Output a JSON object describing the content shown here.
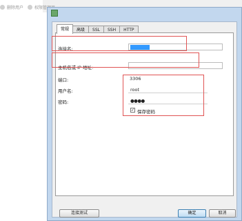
{
  "toolbar": {
    "delete_user": "删除用户",
    "privilege_manager": "权限管理器"
  },
  "tabs": [
    "常规",
    "高级",
    "SSL",
    "SSH",
    "HTTP"
  ],
  "form": {
    "connection_name_label": "连接名:",
    "host_label": "主机名或 IP 地址:",
    "port_label": "端口:",
    "port_value": "3306",
    "username_label": "用户名:",
    "username_value": "root",
    "password_label": "密码:",
    "password_value": "●●●●",
    "save_password_label": "保存密码",
    "save_password_checked": true
  },
  "buttons": {
    "test_connection": "连接测试",
    "ok": "确定",
    "cancel": "取消"
  },
  "colors": {
    "highlight": "#e05353",
    "selection": "#3399ff"
  }
}
